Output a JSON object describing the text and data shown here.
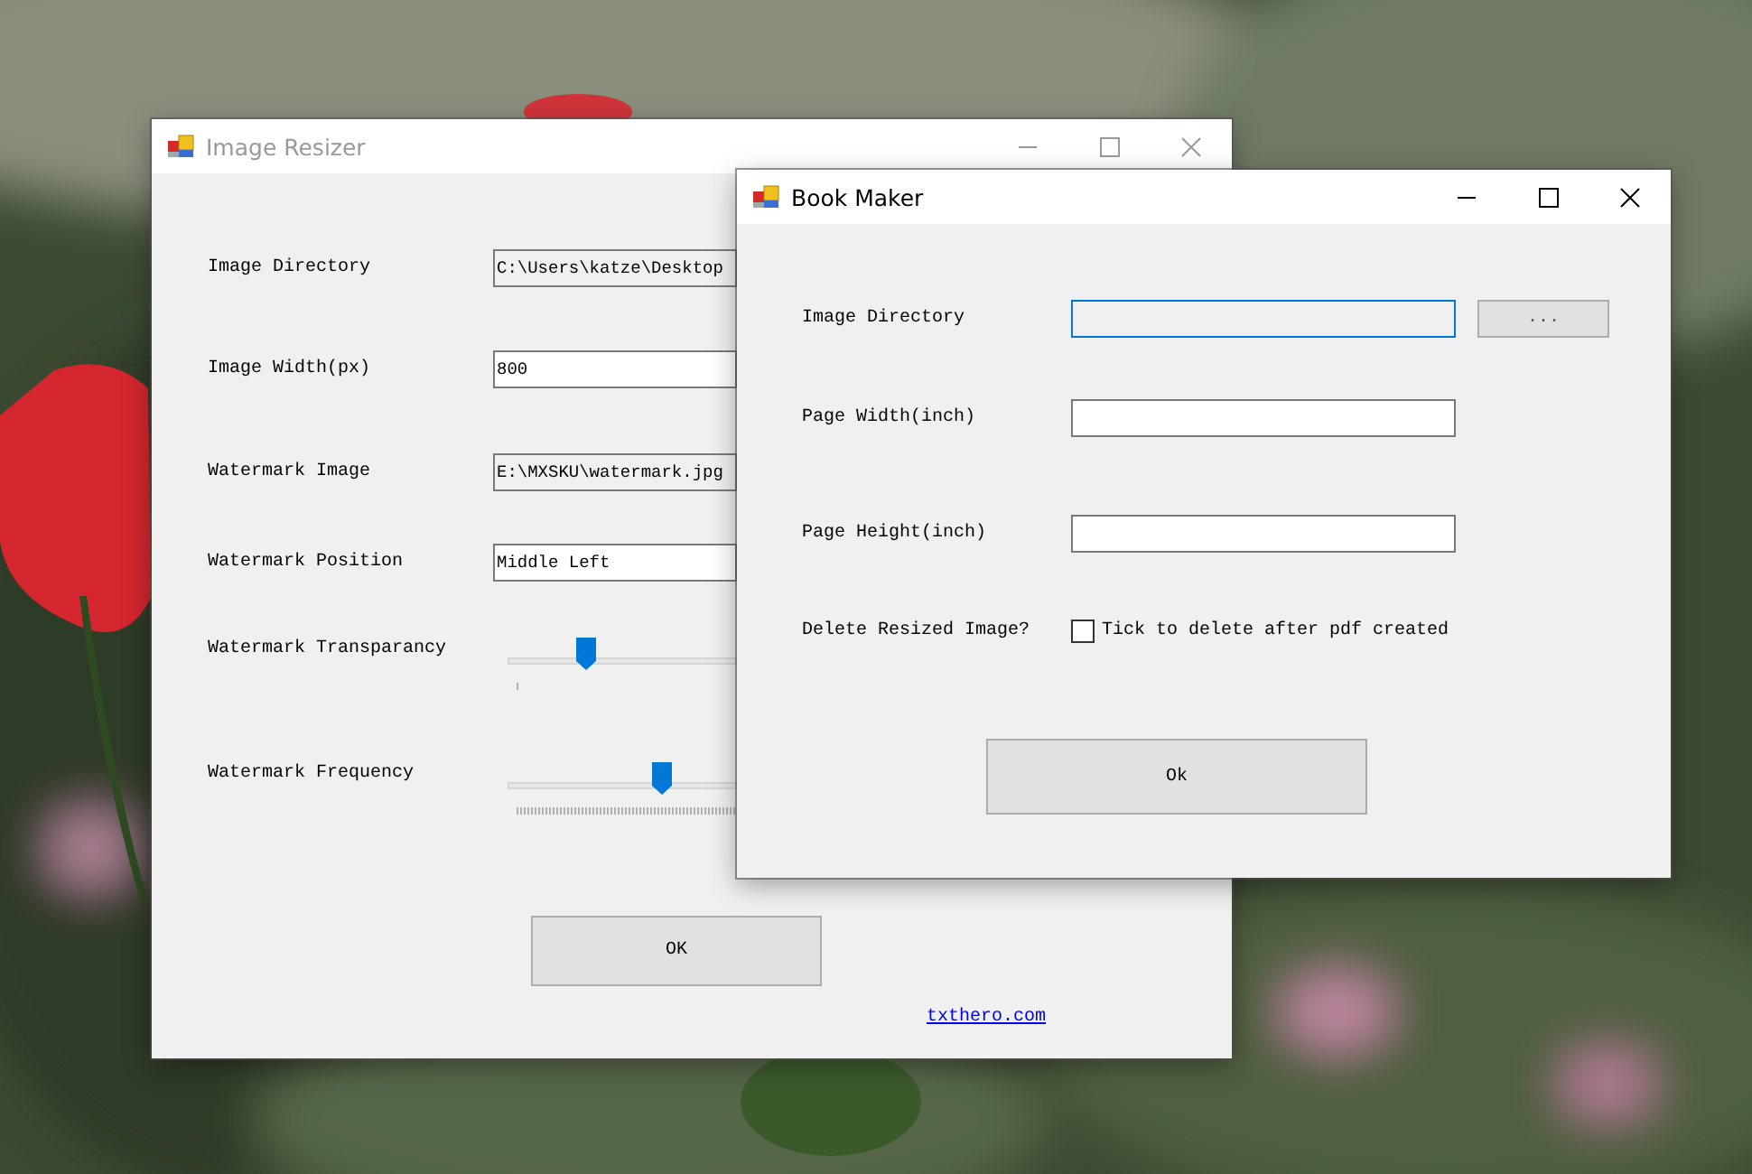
{
  "windows": [
    {
      "title": "Image Resizer",
      "active": false,
      "fields": [
        {
          "label": "Image Directory",
          "value": "C:\\Users\\katze\\Desktop",
          "read_only": true,
          "focused": false
        },
        {
          "label": "Image Width(px)",
          "value": "800",
          "read_only": false,
          "focused": false
        },
        {
          "label": "Watermark Image",
          "value": "E:\\MXSKU\\watermark.jpg",
          "read_only": true,
          "focused": false
        },
        {
          "label": "Watermark Position",
          "value": "Middle Left",
          "read_only": false,
          "focused": false
        }
      ],
      "sliders": [
        {
          "label": "Watermark Transparancy",
          "level": 0.33
        },
        {
          "label": "Watermark Frequency",
          "level": 0.69
        }
      ],
      "ok_button": "OK",
      "link": "txthero.com"
    },
    {
      "title": "Book Maker",
      "active": true,
      "fields": [
        {
          "label": "Image Directory",
          "read_only": true,
          "focused": true,
          "button": "..."
        },
        {
          "label": "Page Width(inch)",
          "read_only": false,
          "focused": false
        },
        {
          "label": "Page Height(inch)",
          "read_only": false,
          "focused": false
        }
      ],
      "checkbox": {
        "label": "Delete Resized Image?",
        "text": "Tick to delete after pdf created",
        "checked": false
      },
      "ok_button": "Ok"
    }
  ]
}
